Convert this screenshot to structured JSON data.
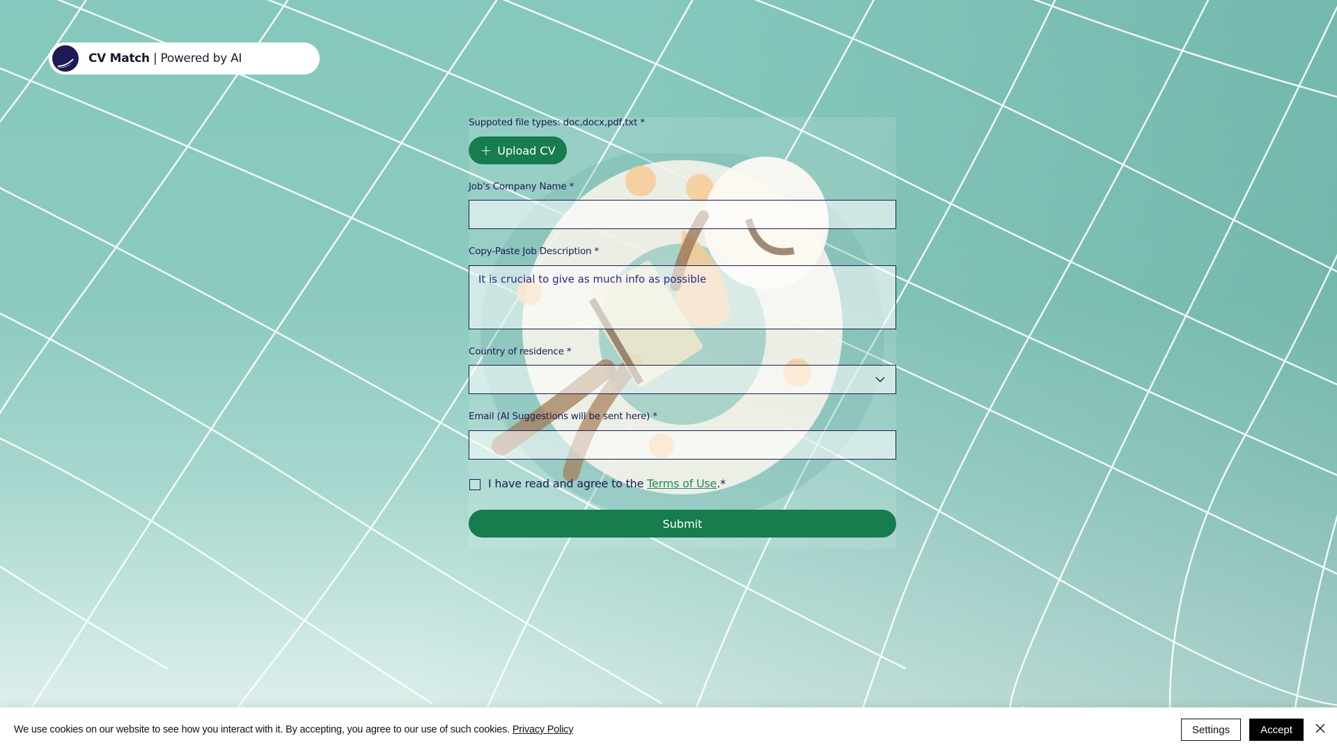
{
  "header": {
    "brand_name": "CV Match",
    "brand_tagline": " | Powered by AI",
    "logo_icon": "crescent-moon-logo-icon"
  },
  "form": {
    "upload": {
      "label": "Suppoted file types: doc,docx,pdf,txt *",
      "button_label": "Upload CV",
      "button_icon": "plus-icon"
    },
    "company_name": {
      "label": "Job's Company Name *",
      "value": ""
    },
    "job_description": {
      "label": "Copy-Paste Job Description *",
      "placeholder": "It is crucial to give as much info as possible",
      "value": ""
    },
    "country": {
      "label": "Country of residence *",
      "selected": "",
      "icon": "chevron-down-icon"
    },
    "email": {
      "label": "Email (AI Suggestions will be sent here) *",
      "value": ""
    },
    "terms": {
      "prefix": "I have read and agree to the ",
      "link_label": "Terms of Use",
      "suffix": ".*",
      "checked": false
    },
    "submit_label": "Submit"
  },
  "cookie_banner": {
    "text": "We use cookies on our website to see how you interact with it. By accepting, you agree to our use of such cookies. ",
    "privacy_link": "Privacy Policy",
    "settings_label": "Settings",
    "accept_label": "Accept",
    "close_icon": "close-icon"
  },
  "colors": {
    "primary_green": "#177c4e",
    "navy": "#1b1a55",
    "link_green": "#1f8a5a",
    "background_teal": "#86c8bd"
  }
}
